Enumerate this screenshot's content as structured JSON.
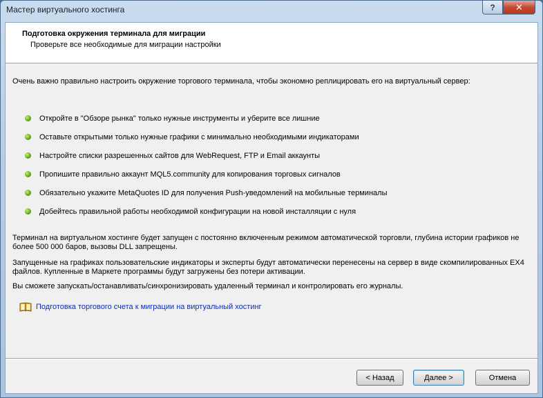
{
  "window": {
    "title": "Мастер виртуального хостинга",
    "help_glyph": "?",
    "close_glyph": "✕"
  },
  "header": {
    "title": "Подготовка окружения терминала для миграции",
    "subtitle": "Проверьте все необходимые для миграции настройки"
  },
  "intro": "Очень важно правильно настроить окружение торгового терминала, чтобы экономно реплицировать его на виртуальный сервер:",
  "bullets": [
    "Откройте в \"Обзоре рынка\" только нужные инструменты и уберите все лишние",
    "Оставьте открытыми только нужные графики с минимально необходимыми индикаторами",
    "Настройте списки разрешенных сайтов для WebRequest, FTP и Email аккаунты",
    "Пропишите правильно аккаунт MQL5.community для копирования торговых сигналов",
    "Обязательно укажите MetaQuotes ID для получения Push-уведомлений на мобильные терминалы",
    "Добейтесь правильной работы необходимой конфигурации на новой инсталляции с нуля"
  ],
  "paragraphs": [
    "Терминал на виртуальном хостинге будет запущен с постоянно включенным режимом автоматической торговли, глубина истории графиков не более 500 000 баров, вызовы DLL запрещены.",
    "Запущенные на графиках пользовательские индикаторы и эксперты будут автоматически перенесены на сервер в виде скомпилированных EX4 файлов. Купленные в Маркете программы будут загружены без потери активации.",
    "Вы сможете запускать/останавливать/синхронизировать удаленный терминал и контролировать его журналы."
  ],
  "link": {
    "icon": "book-icon",
    "text": "Подготовка торгового счета к миграции на виртуальный хостинг"
  },
  "buttons": {
    "back": "< Назад",
    "next": "Далее >",
    "cancel": "Отмена"
  },
  "colors": {
    "bullet": "#5ea51c",
    "link": "#0a2eb8",
    "close_button": "#c54a33"
  }
}
